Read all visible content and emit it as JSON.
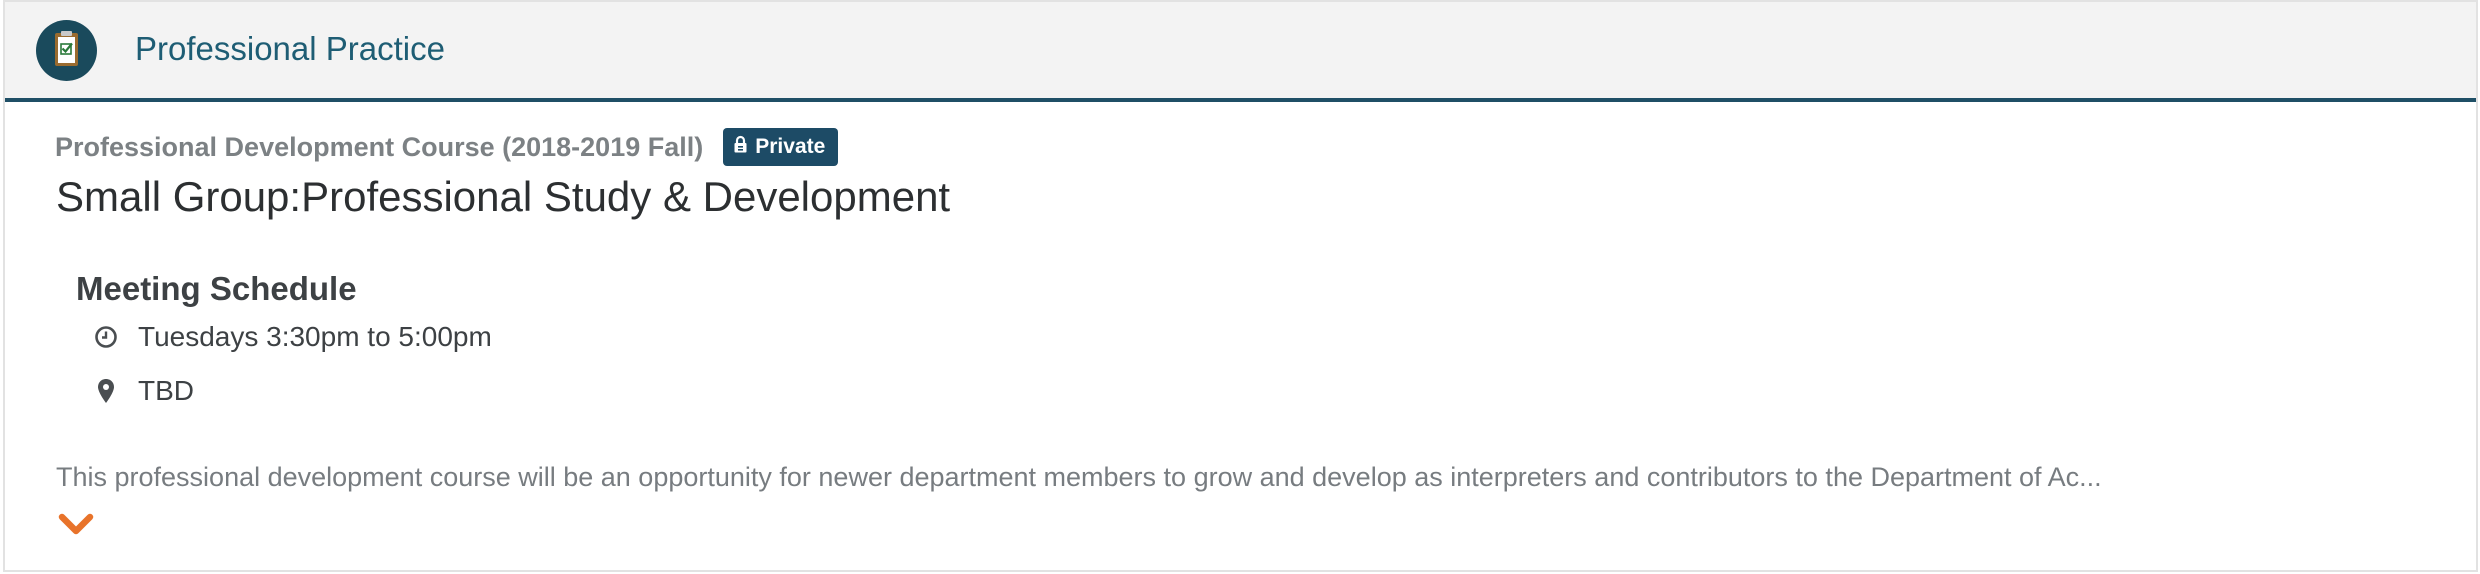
{
  "header": {
    "title": "Professional Practice",
    "icon": "clipboard-check-icon"
  },
  "course": {
    "name": "Professional Development Course (2018-2019 Fall)",
    "visibility_badge": "Private",
    "badge_icon": "lock-icon",
    "group_title": "Small Group:Professional Study & Development"
  },
  "meeting_schedule": {
    "heading": "Meeting Schedule",
    "time": "Tuesdays 3:30pm to 5:00pm",
    "time_icon": "clock-icon",
    "location": "TBD",
    "location_icon": "map-pin-icon"
  },
  "description": "This professional development course will be an opportunity for newer department members to grow and develop as interpreters and contributors to the Department of Ac...",
  "expand_icon": "chevron-down-icon",
  "colors": {
    "header_bg": "#f3f3f3",
    "header_accent": "#1f4f66",
    "badge_bg": "#1d4b66",
    "chevron": "#e8732a",
    "title_teal": "#1e5d74"
  }
}
